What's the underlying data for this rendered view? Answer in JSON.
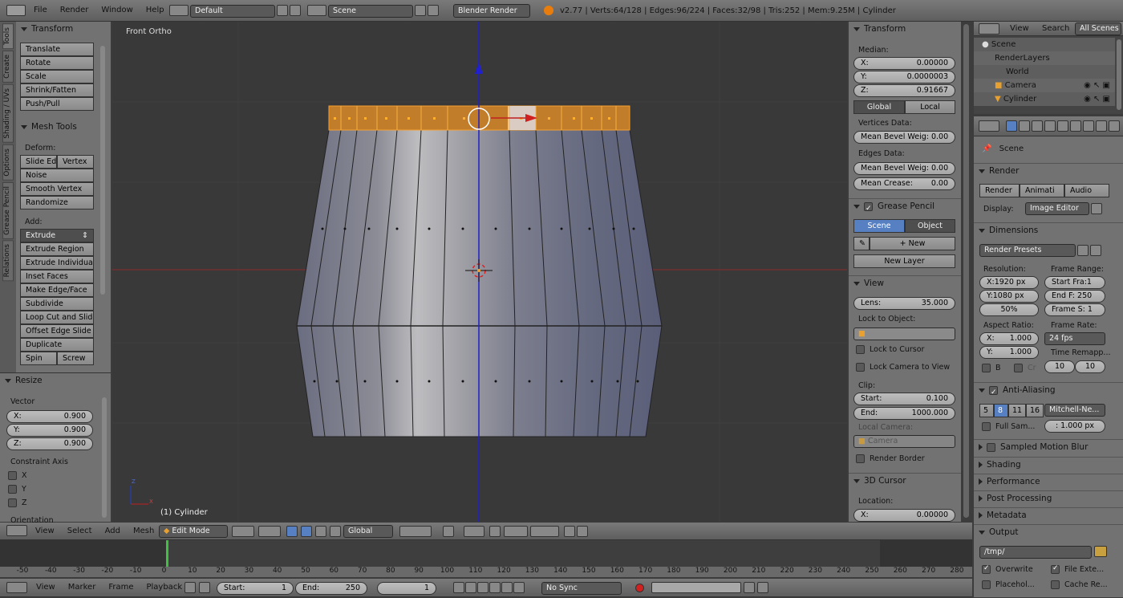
{
  "top_menu": {
    "items": [
      "File",
      "Render",
      "Window",
      "Help"
    ],
    "layout": "Default",
    "scene": "Scene",
    "engine": "Blender Render",
    "stats": "v2.77 | Verts:64/128 | Edges:96/224 | Faces:32/98 | Tris:252 | Mem:9.25M | Cylinder"
  },
  "vtabs": [
    "Tools",
    "Create",
    "Shading / UVs",
    "Options",
    "Grease Pencil",
    "Relations"
  ],
  "tools": {
    "transform_title": "Transform",
    "transform_buttons": [
      "Translate",
      "Rotate",
      "Scale",
      "Shrink/Fatten",
      "Push/Pull"
    ],
    "mesh_tools_title": "Mesh Tools",
    "deform_label": "Deform:",
    "slide_edge": "Slide Ed",
    "vertex": "Vertex",
    "deform_buttons": [
      "Noise",
      "Smooth Vertex",
      "Randomize"
    ],
    "add_label": "Add:",
    "extrude": "Extrude",
    "add_buttons": [
      "Extrude Region",
      "Extrude Individual",
      "Inset Faces",
      "Make Edge/Face",
      "Subdivide",
      "Loop Cut and Slide",
      "Offset Edge Slide",
      "Duplicate"
    ],
    "spin": "Spin",
    "screw": "Screw"
  },
  "resize": {
    "title": "Resize",
    "vector_label": "Vector",
    "x": "0.900",
    "y": "0.900",
    "z": "0.900",
    "constraint_label": "Constraint Axis",
    "axes": [
      "X",
      "Y",
      "Z"
    ],
    "orientation_label": "Orientation"
  },
  "viewport": {
    "view_name": "Front Ortho",
    "object_label": "(1) Cylinder",
    "axis_z": "Z",
    "axis_x": "X"
  },
  "nprops": {
    "transform_title": "Transform",
    "median_label": "Median:",
    "x": "0.00000",
    "y": "0.0000003",
    "z": "0.91667",
    "global": "Global",
    "local": "Local",
    "vertices_data": "Vertices Data:",
    "mean_bevel_weight": "Mean Bevel Weig: 0.00",
    "edges_data": "Edges Data:",
    "mean_bevel_weight2": "Mean Bevel Weig: 0.00",
    "mean_crease_label": "Mean Crease:",
    "mean_crease": "0.00",
    "grease_pencil": "Grease Pencil",
    "scene": "Scene",
    "object": "Object",
    "new": "New",
    "new_layer": "New Layer",
    "view_title": "View",
    "lens_label": "Lens:",
    "lens": "35.000",
    "lock_to_object": "Lock to Object:",
    "lock_to_cursor": "Lock to Cursor",
    "lock_camera": "Lock Camera to View",
    "clip_label": "Clip:",
    "start_label": "Start:",
    "start": "0.100",
    "end_label": "End:",
    "end": "1000.000",
    "local_camera": "Local Camera:",
    "camera": "Camera",
    "render_border": "Render Border",
    "cursor_title": "3D Cursor",
    "location_label": "Location:",
    "loc_x": "0.00000"
  },
  "outliner": {
    "view": "View",
    "search": "Search",
    "all_scenes": "All Scenes",
    "items": [
      "Scene",
      "RenderLayers",
      "World",
      "Camera",
      "Cylinder"
    ]
  },
  "properties": {
    "scene": "Scene",
    "render_title": "Render",
    "render_btn": "Render",
    "anim_btn": "Animati",
    "audio_btn": "Audio",
    "display_label": "Display:",
    "display": "Image Editor",
    "dimensions": "Dimensions",
    "render_presets": "Render Presets",
    "resolution": "Resolution:",
    "frame_range": "Frame Range:",
    "res_x": "X:1920 px",
    "res_y": "Y:1080 px",
    "res_pct": "50%",
    "start_frame": "Start Fra:1",
    "end_frame": "End F: 250",
    "frame_step": "Frame S: 1",
    "aspect": "Aspect Ratio:",
    "frame_rate": "Frame Rate:",
    "asp_x_label": "X:",
    "asp_x": "1.000",
    "asp_y_label": "Y:",
    "asp_y": "1.000",
    "fps": "24 fps",
    "time_remap": "Time Remapp...",
    "remap_old": "10",
    "remap_new": "10",
    "b": "B",
    "cr": "Cr",
    "aa": "Anti-Aliasing",
    "aa_samples": [
      "5",
      "8",
      "11",
      "16"
    ],
    "aa_filter": "Mitchell-Ne...",
    "full_sample": "Full Sam...",
    "filter_size": ": 1.000 px",
    "motion_blur": "Sampled Motion Blur",
    "shading": "Shading",
    "performance": "Performance",
    "post": "Post Processing",
    "metadata": "Metadata",
    "output": "Output",
    "path": "/tmp/",
    "overwrite": "Overwrite",
    "file_ext": "File Exte...",
    "placeholders": "Placehol...",
    "cache": "Cache Re..."
  },
  "view3d_header": {
    "menus": [
      "View",
      "Select",
      "Add",
      "Mesh"
    ],
    "mode": "Edit Mode",
    "orientation": "Global"
  },
  "timeline": {
    "ticks": [
      "-50",
      "-40",
      "-30",
      "-20",
      "-10",
      "0",
      "10",
      "20",
      "30",
      "40",
      "50",
      "60",
      "70",
      "80",
      "90",
      "100",
      "110",
      "120",
      "130",
      "140",
      "150",
      "160",
      "170",
      "180",
      "190",
      "200",
      "210",
      "220",
      "230",
      "240",
      "250",
      "260",
      "270",
      "280"
    ],
    "menus": [
      "View",
      "Marker",
      "Frame",
      "Playback"
    ],
    "start_label": "Start:",
    "start": "1",
    "end_label": "End:",
    "end": "250",
    "current": "1",
    "sync": "No Sync"
  },
  "colors": {
    "selected": "#f5a030",
    "accent": "#5680c2",
    "x_axis": "#c02020",
    "z_axis": "#2020c0"
  }
}
